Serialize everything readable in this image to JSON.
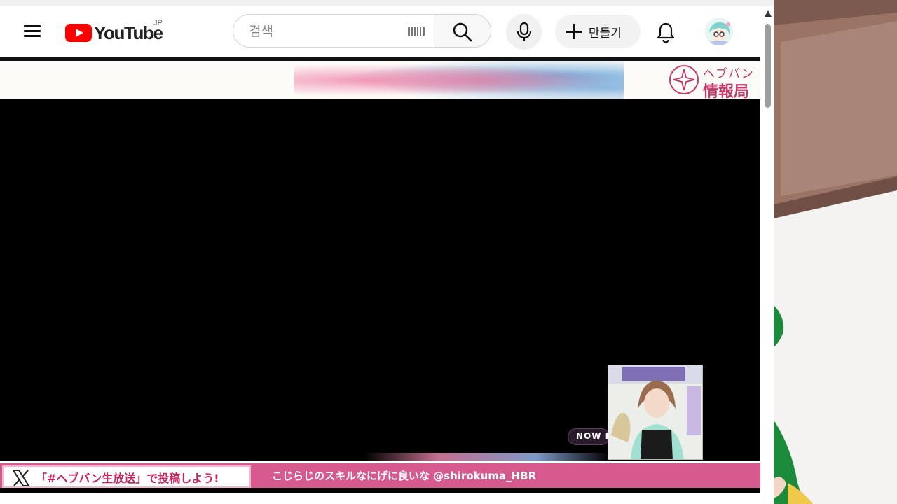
{
  "header": {
    "logo_text": "YouTube",
    "country_code": "JP",
    "search_placeholder": "검색",
    "create_label": "만들기"
  },
  "player": {
    "channel_name_top": "ヘブバン",
    "channel_name_bottom": "情報局",
    "ticker_hashtag": "「#ヘブバン生放送」で投稿しよう!",
    "ticker_message": "こじらじのスキルなにげに良いな @shirokuma_HBR",
    "now_badge": "NOW L"
  },
  "colors": {
    "youtube_red": "#ff0000",
    "banner_accent": "#c23c6b",
    "ticker_bg": "#d65a8e"
  },
  "icons": [
    "menu-icon",
    "youtube-logo",
    "keyboard-icon",
    "search-icon",
    "microphone-icon",
    "plus-icon",
    "bell-icon",
    "x-logo"
  ]
}
